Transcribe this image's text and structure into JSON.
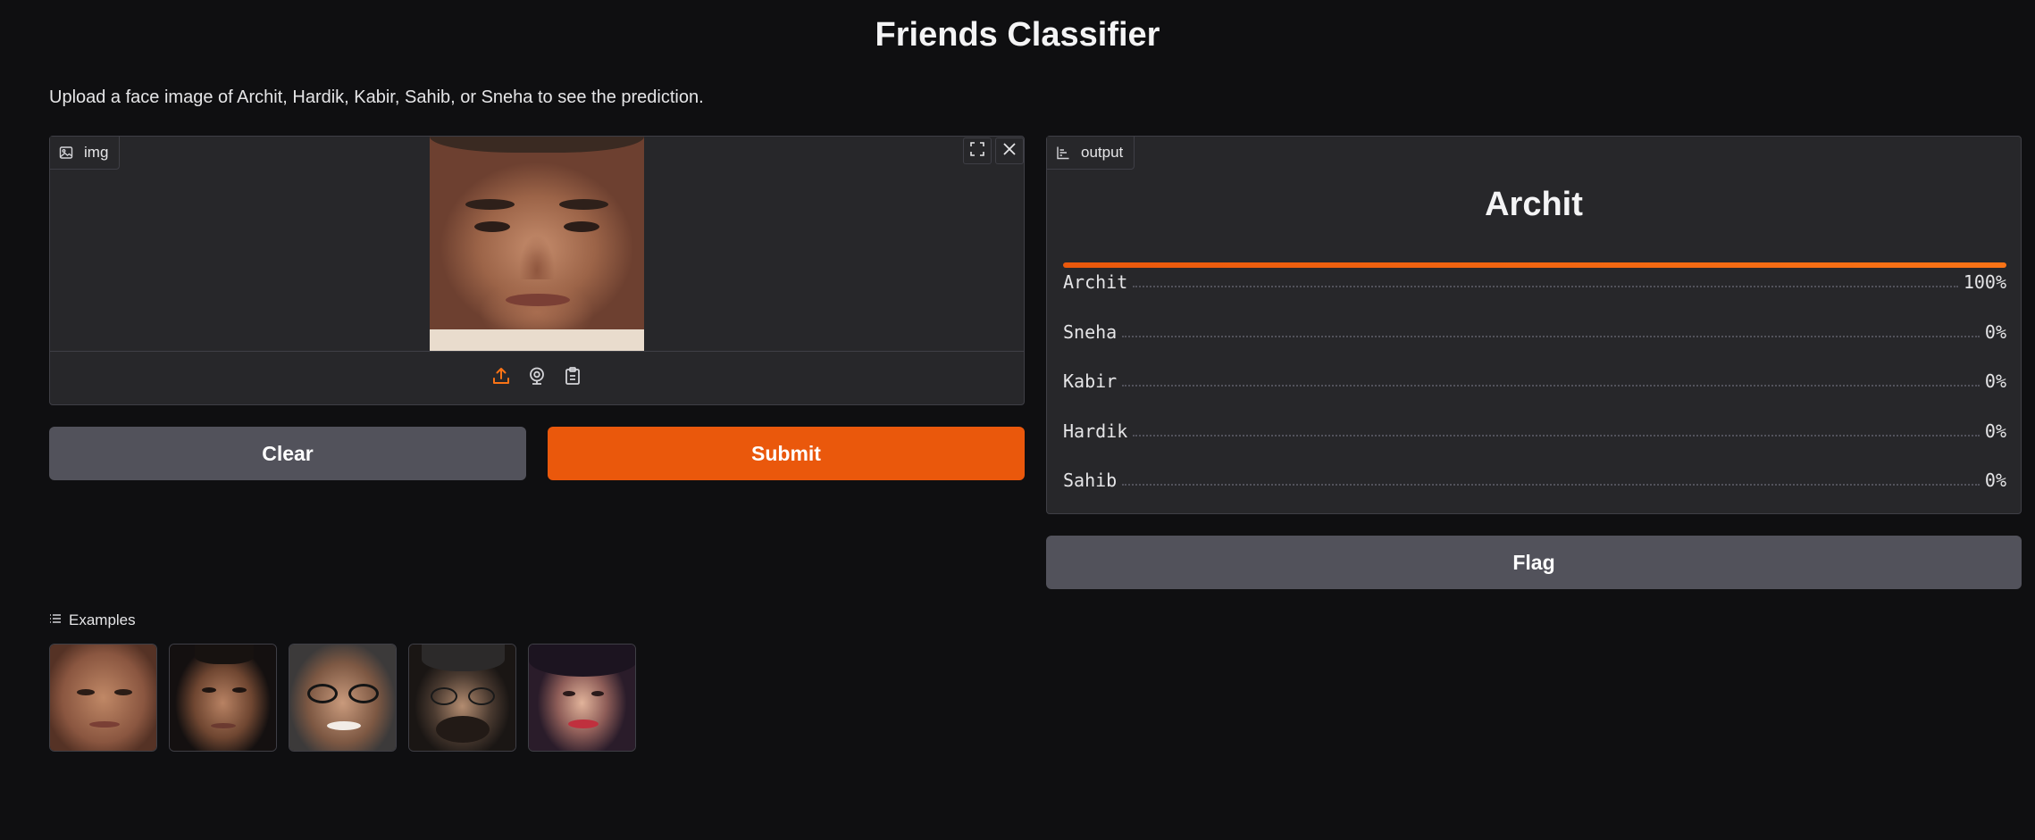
{
  "app": {
    "title": "Friends Classifier",
    "description": "Upload a face image of Archit, Hardik, Kabir, Sahib, or Sneha to see the prediction."
  },
  "input": {
    "label": "img",
    "icon": "image-icon",
    "corner_buttons": [
      "fullscreen-icon",
      "close-icon"
    ],
    "sources": [
      "upload-icon",
      "webcam-icon",
      "clipboard-icon"
    ]
  },
  "buttons": {
    "clear": "Clear",
    "submit": "Submit",
    "flag": "Flag"
  },
  "output": {
    "label": "output",
    "icon": "bar-chart-icon",
    "predicted_label": "Archit",
    "confidences": [
      {
        "name": "Archit",
        "percent": "100%",
        "fraction": 1.0
      },
      {
        "name": "Sneha",
        "percent": "0%",
        "fraction": 0.0
      },
      {
        "name": "Kabir",
        "percent": "0%",
        "fraction": 0.0
      },
      {
        "name": "Hardik",
        "percent": "0%",
        "fraction": 0.0
      },
      {
        "name": "Sahib",
        "percent": "0%",
        "fraction": 0.0
      }
    ]
  },
  "examples": {
    "label": "Examples",
    "icon": "list-icon",
    "count": 5
  },
  "colors": {
    "background": "#0f0f11",
    "panel": "#27272a",
    "primary": "#ea580c",
    "secondary": "#52525b"
  }
}
